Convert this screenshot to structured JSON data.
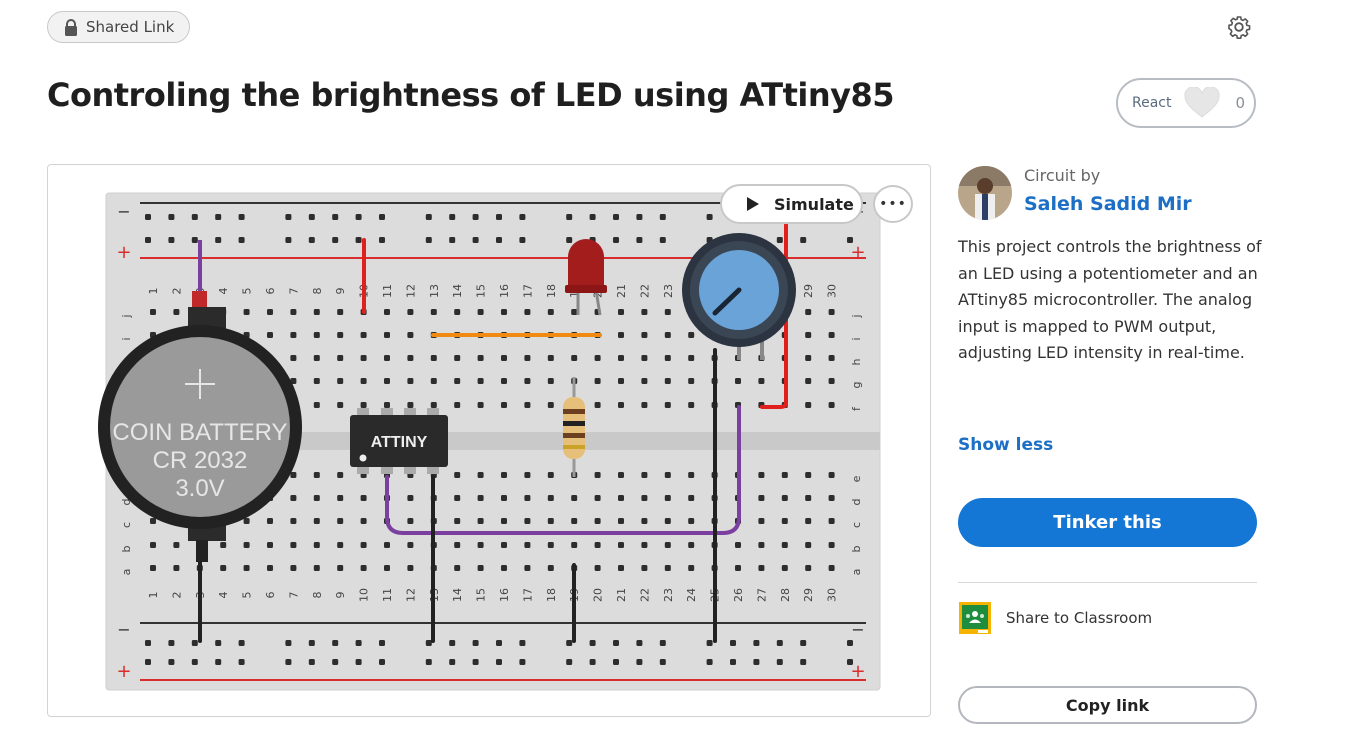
{
  "header": {
    "shared_link_label": "Shared Link",
    "title": "Controling the brightness of LED using ATtiny85",
    "react_label": "React",
    "react_count": "0"
  },
  "circuit": {
    "simulate_label": "Simulate",
    "more_label": "•••",
    "battery_line1": "COIN BATTERY",
    "battery_line2": "CR 2032",
    "battery_line3": "3.0V",
    "chip_label": "ATTINY",
    "column_numbers": [
      "1",
      "2",
      "3",
      "4",
      "5",
      "6",
      "7",
      "8",
      "9",
      "10",
      "11",
      "12",
      "13",
      "14",
      "15",
      "16",
      "17",
      "18",
      "19",
      "20",
      "21",
      "22",
      "23",
      "24",
      "25",
      "26",
      "27",
      "28",
      "29",
      "30"
    ],
    "row_letters_top": [
      "j",
      "i",
      "h",
      "g",
      "f"
    ],
    "row_letters_bottom": [
      "e",
      "d",
      "c",
      "b",
      "a"
    ],
    "rail_minus": "−",
    "rail_plus": "+"
  },
  "panel": {
    "circuit_by": "Circuit by",
    "author": "Saleh Sadid Mir",
    "description": "This project controls the brightness of an LED using a potentiometer and an ATtiny85 microcontroller. The analog input is mapped to PWM output, adjusting LED intensity in real-time.",
    "show_less": "Show less",
    "tinker_label": "Tinker this",
    "classroom_label": "Share to Classroom",
    "copy_link_label": "Copy link"
  },
  "colors": {
    "accent": "#1477d6",
    "link": "#1c6fc4",
    "wire_red": "#e0201c",
    "wire_purple": "#7b3fa0",
    "wire_orange": "#f08a10",
    "wire_black": "#222222"
  }
}
